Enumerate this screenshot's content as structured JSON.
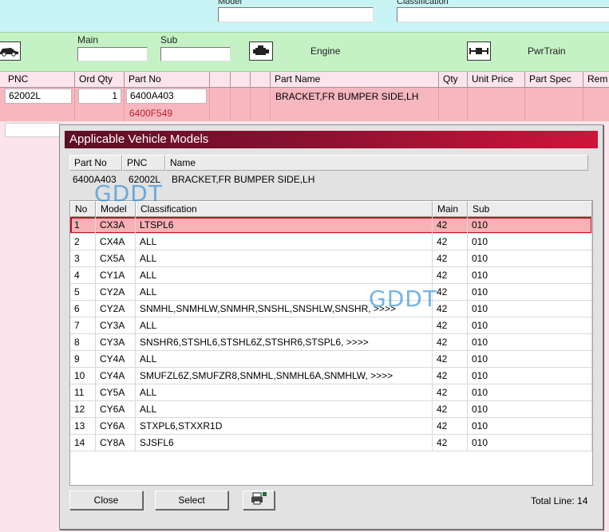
{
  "top": {
    "model_label": "Model",
    "classification_label": "Classification"
  },
  "green": {
    "main_label": "Main",
    "sub_label": "Sub",
    "engine_label": "Engine",
    "pwrtrain_label": "PwrTrain",
    "icons": [
      "car-icon",
      "engine-icon",
      "powertrain-icon"
    ]
  },
  "grid": {
    "headers": [
      "PNC",
      "Ord Qty",
      "Part No",
      "",
      "",
      "",
      "Part Name",
      "Qty",
      "Unit Price",
      "Part Spec",
      "Rem"
    ],
    "row": {
      "pnc": "62002L",
      "ord_qty": "1",
      "part_no": "6400A403",
      "part_no_alt": "6400F549",
      "part_name": "BRACKET,FR BUMPER SIDE,LH"
    }
  },
  "dialog": {
    "title": "Applicable Vehicle Models",
    "info_headers": [
      "Part No",
      "PNC",
      "Name"
    ],
    "info_values": {
      "part_no": "6400A403",
      "pnc": "62002L",
      "name": "BRACKET,FR BUMPER SIDE,LH"
    },
    "list_headers": [
      "No",
      "Model",
      "Classification",
      "Main",
      "Sub"
    ],
    "rows": [
      {
        "no": "1",
        "model": "CX3A",
        "classification": "LTSPL6",
        "main": "42",
        "sub": "010"
      },
      {
        "no": "2",
        "model": "CX4A",
        "classification": "ALL",
        "main": "42",
        "sub": "010"
      },
      {
        "no": "3",
        "model": "CX5A",
        "classification": "ALL",
        "main": "42",
        "sub": "010"
      },
      {
        "no": "4",
        "model": "CY1A",
        "classification": "ALL",
        "main": "42",
        "sub": "010"
      },
      {
        "no": "5",
        "model": "CY2A",
        "classification": "ALL",
        "main": "42",
        "sub": "010"
      },
      {
        "no": "6",
        "model": "CY2A",
        "classification": "SNMHL,SNMHLW,SNMHR,SNSHL,SNSHLW,SNSHR,  >>>>",
        "main": "42",
        "sub": "010"
      },
      {
        "no": "7",
        "model": "CY3A",
        "classification": "ALL",
        "main": "42",
        "sub": "010"
      },
      {
        "no": "8",
        "model": "CY3A",
        "classification": "SNSHR6,STSHL6,STSHL6Z,STSHR6,STSPL6,  >>>>",
        "main": "42",
        "sub": "010"
      },
      {
        "no": "9",
        "model": "CY4A",
        "classification": "ALL",
        "main": "42",
        "sub": "010"
      },
      {
        "no": "10",
        "model": "CY4A",
        "classification": "SMUFZL6Z,SMUFZR8,SNMHL,SNMHL6A,SNMHLW,  >>>>",
        "main": "42",
        "sub": "010"
      },
      {
        "no": "11",
        "model": "CY5A",
        "classification": "ALL",
        "main": "42",
        "sub": "010"
      },
      {
        "no": "12",
        "model": "CY6A",
        "classification": "ALL",
        "main": "42",
        "sub": "010"
      },
      {
        "no": "13",
        "model": "CY6A",
        "classification": "STXPL6,STXXR1D",
        "main": "42",
        "sub": "010"
      },
      {
        "no": "14",
        "model": "CY8A",
        "classification": "SJSFL6",
        "main": "42",
        "sub": "010"
      }
    ],
    "close_label": "Close",
    "select_label": "Select",
    "print_icon": "printer-icon",
    "total_label": "Total Line: 14"
  },
  "watermark": "GDDT",
  "colors": {
    "title_start": "#5c0f24",
    "title_end": "#d0143b",
    "selected_row": "#f5b3b6",
    "green_band": "#c5f2c5",
    "top_band": "#c9f4f6"
  }
}
